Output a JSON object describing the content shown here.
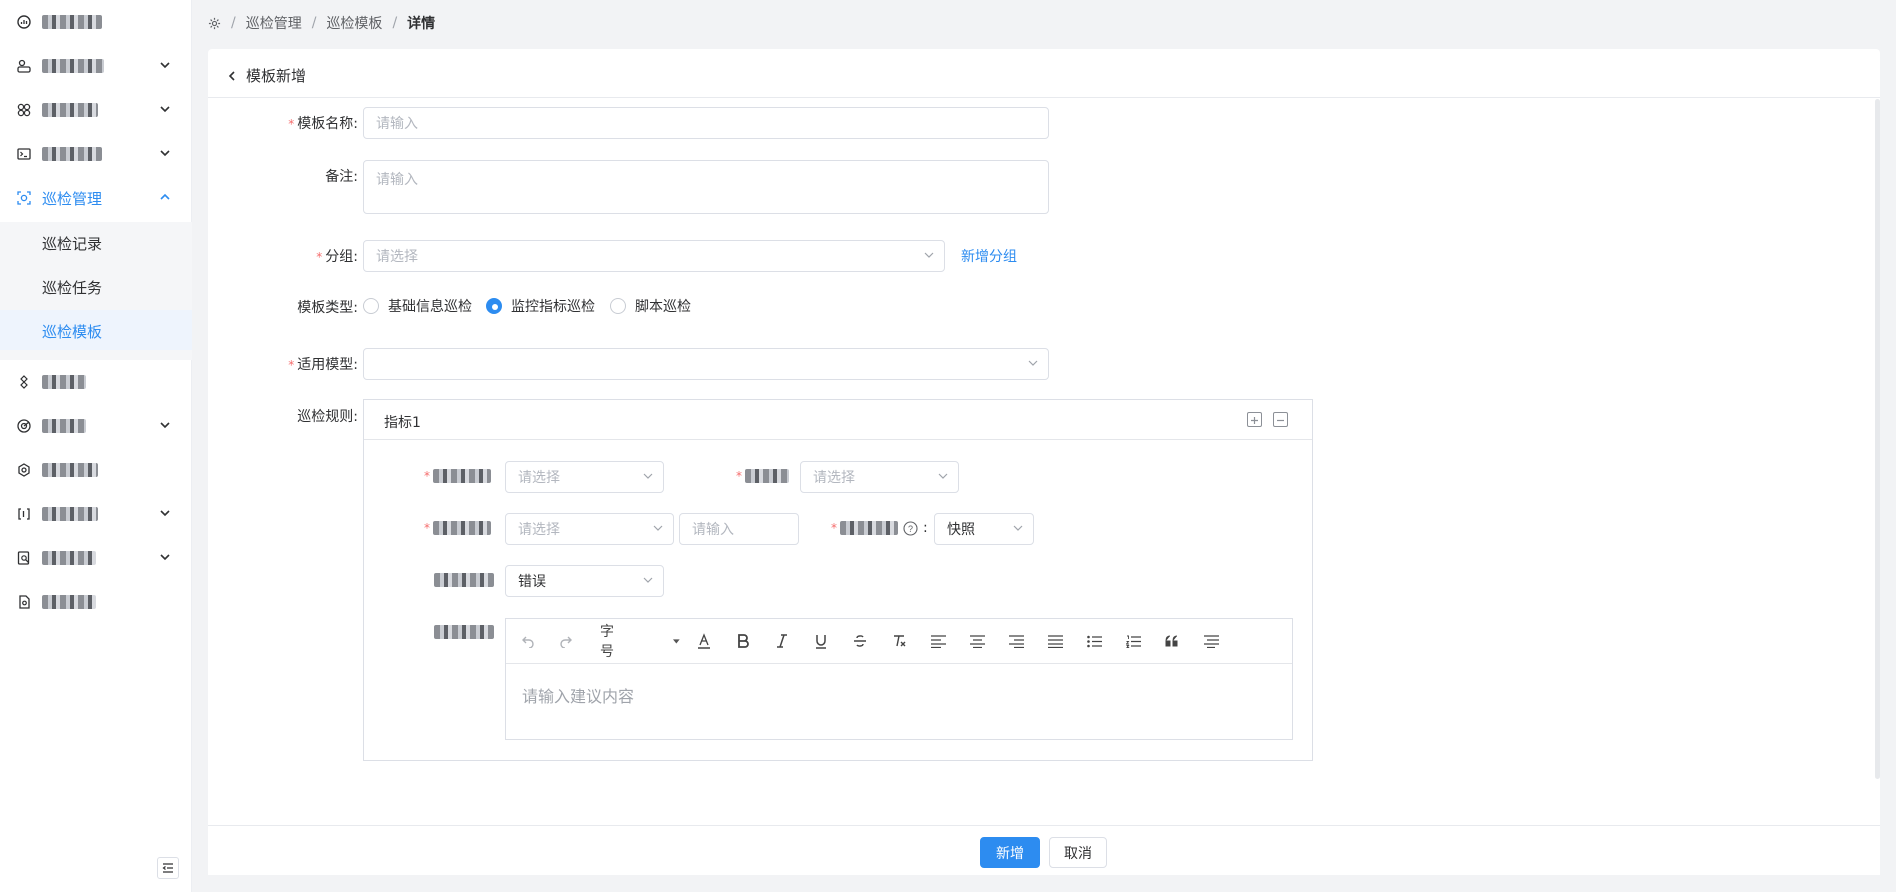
{
  "colors": {
    "accent": "#2d8cf0",
    "required": "#f56c6c",
    "border": "#dcdfe6"
  },
  "sidebar": {
    "items": [
      {
        "icon": "dashboard-icon",
        "label": "",
        "expand": false
      },
      {
        "icon": "user-group-icon",
        "label": "",
        "expand": true
      },
      {
        "icon": "cluster-icon",
        "label": "",
        "expand": true
      },
      {
        "icon": "terminal-icon",
        "label": "",
        "expand": true
      },
      {
        "icon": "inspection-icon",
        "label": "巡检管理",
        "expand": true,
        "open": true
      },
      {
        "icon": "network-icon",
        "label": "",
        "expand": false
      },
      {
        "icon": "radar-icon",
        "label": "",
        "expand": true
      },
      {
        "icon": "settings-icon",
        "label": "",
        "expand": false
      },
      {
        "icon": "brackets-icon",
        "label": "",
        "expand": true
      },
      {
        "icon": "report-icon",
        "label": "",
        "expand": true
      },
      {
        "icon": "document-icon",
        "label": "",
        "expand": false
      }
    ],
    "submenu": [
      "巡检记录",
      "巡检任务",
      "巡检模板"
    ],
    "submenu_active": "巡检模板"
  },
  "breadcrumb": {
    "items": [
      "巡检管理",
      "巡检模板"
    ],
    "current": "详情"
  },
  "header": {
    "title": "模板新增"
  },
  "form": {
    "name": {
      "label": "模板名称:",
      "placeholder": "请输入"
    },
    "remark": {
      "label": "备注:",
      "placeholder": "请输入"
    },
    "group": {
      "label": "分组:",
      "placeholder": "请选择",
      "add_link": "新增分组"
    },
    "type": {
      "label": "模板类型:",
      "options": [
        "基础信息巡检",
        "监控指标巡检",
        "脚本巡检"
      ],
      "selected": "监控指标巡检"
    },
    "model": {
      "label": "适用模型:",
      "value": ""
    },
    "rules": {
      "label": "巡检规则:"
    }
  },
  "rule": {
    "title": "指标1",
    "indicator": {
      "label": "",
      "placeholder": "请选择"
    },
    "condition": {
      "label": "",
      "placeholder": "请选择"
    },
    "threshold": {
      "label": "",
      "select_placeholder": "请选择",
      "input_placeholder": "请输入"
    },
    "method": {
      "label": "",
      "value": "快照"
    },
    "level": {
      "label": "",
      "value": "错误"
    },
    "advice": {
      "label": "",
      "font_size_label": "字号",
      "placeholder": "请输入建议内容"
    }
  },
  "footer": {
    "submit": "新增",
    "cancel": "取消"
  }
}
